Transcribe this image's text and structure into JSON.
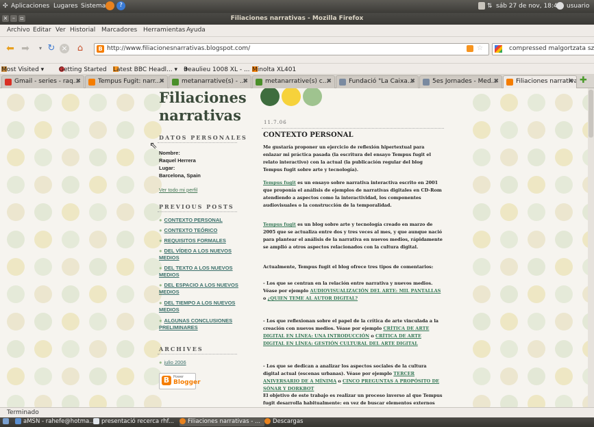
{
  "gnome_panel": {
    "menus": [
      "Aplicaciones",
      "Lugares",
      "Sistema"
    ],
    "clock": "sáb 27 de nov, 18:49",
    "user": "usuario"
  },
  "window": {
    "title": "Filiaciones narrativas - Mozilla Firefox"
  },
  "menubar": [
    "Archivo",
    "Editar",
    "Ver",
    "Historial",
    "Marcadores",
    "Herramientas",
    "Ayuda"
  ],
  "navbar": {
    "url": "http://www.filiacionesnarrativas.blogspot.com/",
    "search_value": "compressed malgortzata szperling"
  },
  "bookmarks": [
    "Most Visited ▾",
    "Getting Started",
    "Latest BBC Headl... ▾",
    "Beaulieu 1008 XL - ...",
    "Minolta XL401"
  ],
  "tabs": [
    {
      "label": "Gmail - series - raq...",
      "icon_color": "#d93025"
    },
    {
      "label": "Tempus Fugit: narr...",
      "icon_color": "#f57d00"
    },
    {
      "label": "metanarrative(s) - ...",
      "icon_color": "#4a8f2a"
    },
    {
      "label": "metanarrative(s) c...",
      "icon_color": "#4a8f2a"
    },
    {
      "label": "Fundació \"La Caixa...",
      "icon_color": "#7a8aa0"
    },
    {
      "label": "5es Jornades - Med...",
      "icon_color": "#7a8aa0"
    },
    {
      "label": "Filiaciones narrativas",
      "icon_color": "#f57d00"
    }
  ],
  "blog": {
    "title_line1": "Filiaciones",
    "title_line2": "narrativas",
    "datos_heading": "DATOS PERSONALES",
    "nombre_label": "Nombre:",
    "nombre": "Raquel Herrera",
    "lugar_label": "Lugar:",
    "lugar": "Barcelona, Spain",
    "ver_perfil": "Ver todo mi perfil",
    "previous_heading": "PREVIOUS POSTS",
    "previous_posts": [
      "CONTEXTO PERSONAL",
      "CONTEXTO TEÓRICO",
      "REQUISITOS FORMALES",
      "DEL VÍDEO A LOS NUEVOS MEDIOS",
      "DEL TEXTO A LOS NUEVOS MEDIOS",
      "DEL ESPACIO A LOS NUEVOS MEDIOS",
      "DEL TIEMPO A LOS NUEVOS MEDIOS",
      "ALGUNAS CONCLUSIONES PRELIMINARES"
    ],
    "archives_heading": "ARCHIVES",
    "archive_item": "julio 2006",
    "blogger_badge_top": "Power",
    "blogger_badge": "Blogger",
    "post_date": "11.7.06",
    "post_title": "CONTEXTO PERSONAL",
    "paragraphs": {
      "p1": "Me gustaría proponer un ejercicio de reflexión hipertextual para enlazar mi práctica pasada (la escritura del ensayo Tempus fugit el relato interactivo) con la actual (la publicación regular del blog Tempus fugit sobre arte y tecnología).",
      "p2_link": "Tempus fugit",
      "p2": " es un ensayo sobre narrativa interactiva escrito en 2001 que proponía el análisis de ejemplos de narrativas digitales en CD-Rom atendiendo a aspectos como la interactividad, los componentes audiovisuales o la construcción de la temporalidad.",
      "p3_link": "Tempus fugit",
      "p3": " es un blog sobre arte y tecnología creado en marzo de 2005 que se actualiza entre dos y tres veces al mes, y que aunque nació para plantear el análisis de la narrativa en nuevos medios, rápidamente se amplió a otros aspectos relacionados con la cultura digital.",
      "p4": "Actualmente, Tempus fugit el blog ofrece tres tipos de comentarios:",
      "p5": "- Los que se centran en la relación entre narrativa y nuevos medios. Véase por ejemplo ",
      "p5_link1": "AUDIOVISUALIZACIÓN DEL ARTE: MIL PANTALLAS",
      "p5_mid": " o ",
      "p5_link2": "¿QUIEN TEME AL AUTOR DIGITAL?",
      "p6": "- Los que reflexionan sobre el papel de la crítica de arte vinculada a la creación con nuevos medios. Véase por ejemplo ",
      "p6_link1": "CRÍTICA DE ARTE DIGITAL EN LÍNEA: UNA INTRODUCCIÓN",
      "p6_mid": " o ",
      "p6_link2": "CRÍTICA DE ARTE DIGITAL EN LÍNEA: GESTIÓN CULTURAL DEL ARTE DIGITAL",
      "p7": "- Los que se dedican a analizar los aspectos sociales de la cultura digital actual (escenas urbanas). Véase por ejemplo ",
      "p7_link1": "TERCER ANIVERSARIO DE A MÍNIMA",
      "p7_mid": " o ",
      "p7_link2": "CINCO PREGUNTAS A PROPÓSITO DE SÓNAR Y DORKBOT",
      "p8": "El objetivo de este trabajo es realizar un proceso inverso al que Tempus fugit desarrolla habitualmente: en vez de buscar elementos externos (en Internet, o"
    }
  },
  "status": "Terminado",
  "taskbar": [
    "aMSN - rahefe@hotma...",
    "presentació recerca rhf...",
    "Filiaciones narrativas - ...",
    "Descargas"
  ]
}
